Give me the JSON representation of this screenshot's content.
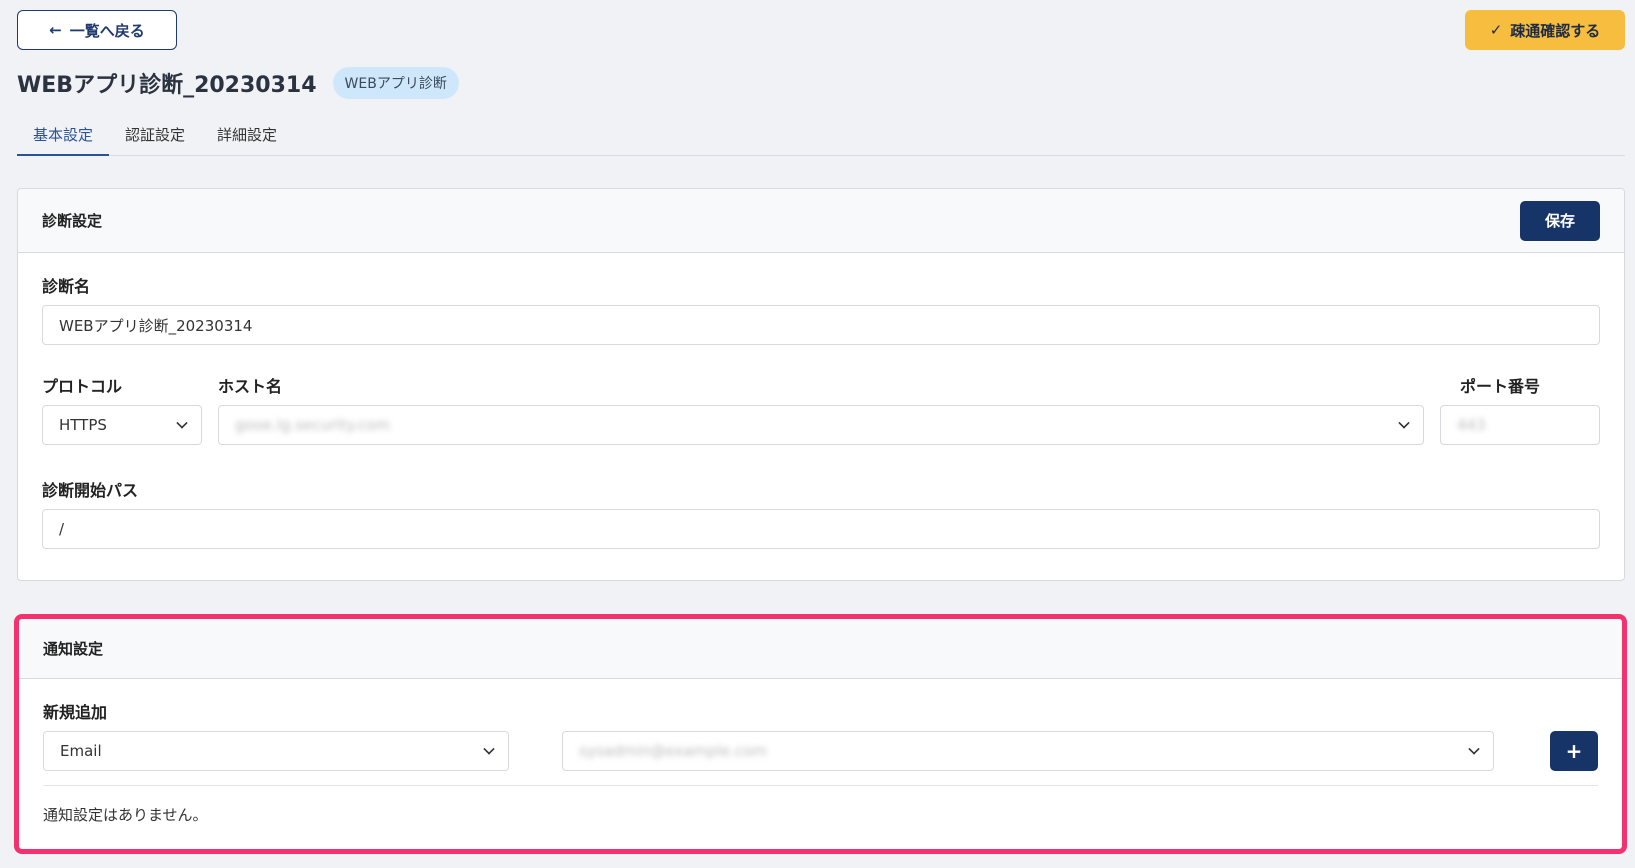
{
  "top": {
    "back_label": "一覧へ戻る",
    "back_arrow": "←",
    "confirm_label": "疎通確認する",
    "confirm_check": "✓"
  },
  "header": {
    "title": "WEBアプリ診断_20230314",
    "badge": "WEBアプリ診断"
  },
  "tabs": [
    {
      "label": "基本設定",
      "active": true
    },
    {
      "label": "認証設定",
      "active": false
    },
    {
      "label": "詳細設定",
      "active": false
    }
  ],
  "scan_settings": {
    "title": "診断設定",
    "save_label": "保存",
    "name_label": "診断名",
    "name_value": "WEBアプリ診断_20230314",
    "protocol_label": "プロトコル",
    "protocol_value": "HTTPS",
    "host_label": "ホスト名",
    "host_value": "gooe.lg.security.com",
    "port_label": "ポート番号",
    "port_value": "443",
    "path_label": "診断開始パス",
    "path_value": "/"
  },
  "notification": {
    "title": "通知設定",
    "new_label": "新規追加",
    "type_value": "Email",
    "recipient_value": "sysadmin@example.com",
    "add_symbol": "+",
    "empty_text": "通知設定はありません。"
  },
  "colors": {
    "primary": "#173468",
    "accent": "#f6bd3e",
    "highlight": "#f4306e",
    "tab_active": "#2a5298"
  }
}
